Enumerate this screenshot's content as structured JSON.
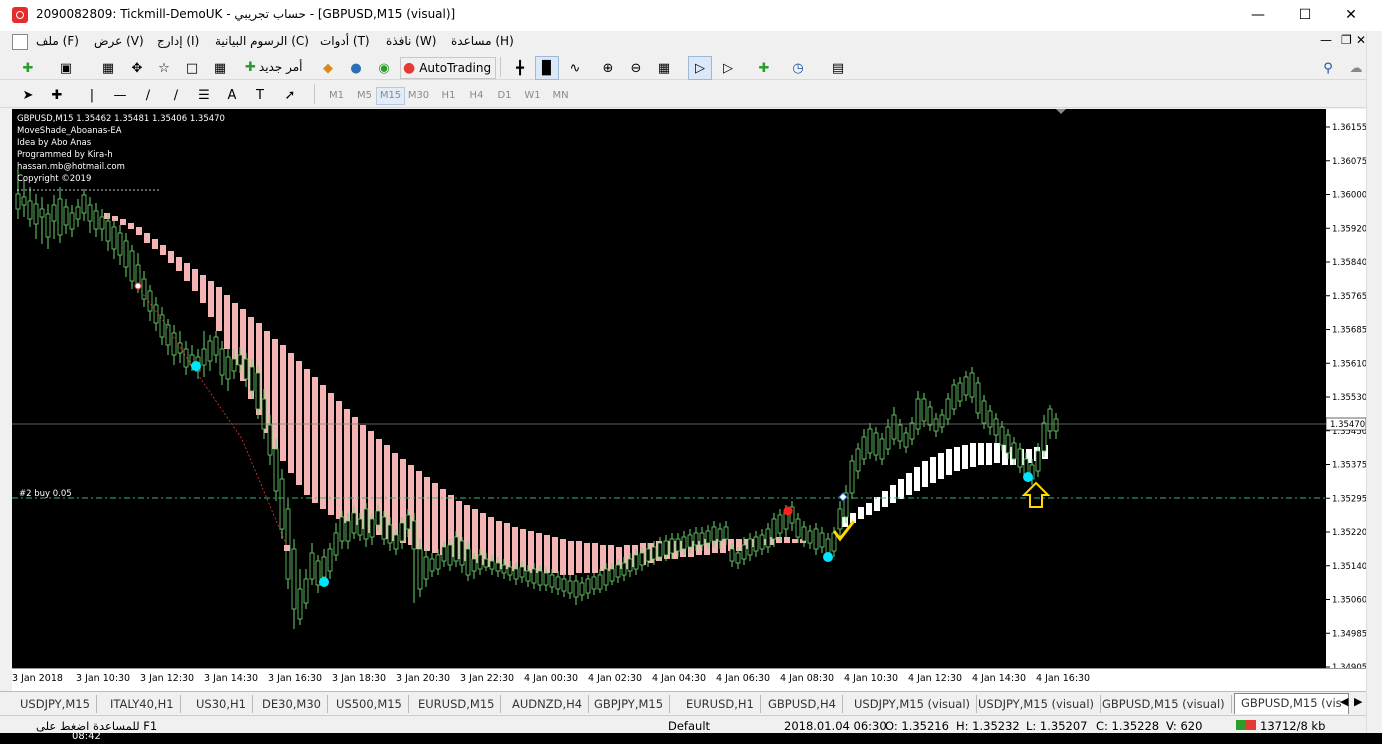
{
  "window": {
    "title": "2090082809: Tickmill-DemoUK - حساب تجريبي - [GBPUSD,M15 (visual)]"
  },
  "menu": {
    "items": [
      "ملف (F)",
      "عرض (V)",
      "إدارج (I)",
      "الرسوم البيانية (C)",
      "أدوات (T)",
      "نافذة (W)",
      "مساعدة (H)"
    ]
  },
  "toolbar": {
    "new_order": "أمر جديد",
    "autotrading": "AutoTrading"
  },
  "timeframes": [
    "M1",
    "M5",
    "M15",
    "M30",
    "H1",
    "H4",
    "D1",
    "W1",
    "MN"
  ],
  "chart": {
    "symbol_line": "GBPUSD,M15  1.35462 1.35481 1.35406 1.35470",
    "ea_lines": [
      "MoveShade_Aboanas-EA",
      "Idea by Abo Anas",
      "Programmed by Kira-h",
      "hassan.mb@hotmail.com",
      "Copyright ©2019"
    ],
    "order_label": "#2 buy 0.05",
    "current_price": "1.35470",
    "price_ticks": [
      "1.36155",
      "1.36075",
      "1.36000",
      "1.35920",
      "1.35840",
      "1.35765",
      "1.35685",
      "1.35610",
      "1.35530",
      "1.35450",
      "1.35375",
      "1.35295",
      "1.35220",
      "1.35140",
      "1.35060",
      "1.34985",
      "1.34905"
    ],
    "time_ticks": [
      "3 Jan 2018",
      "3 Jan 10:30",
      "3 Jan 12:30",
      "3 Jan 14:30",
      "3 Jan 16:30",
      "3 Jan 18:30",
      "3 Jan 20:30",
      "3 Jan 22:30",
      "4 Jan 00:30",
      "4 Jan 02:30",
      "4 Jan 04:30",
      "4 Jan 06:30",
      "4 Jan 08:30",
      "4 Jan 10:30",
      "4 Jan 12:30",
      "4 Jan 14:30",
      "4 Jan 16:30"
    ],
    "colors": {
      "bull": "#d8f7d0",
      "bear": "#6ed66e",
      "shade_down": "#f4b4b4",
      "shade_up": "#ffffff",
      "dot": "#00e5ff",
      "order_line": "#3cb371"
    }
  },
  "tabs": [
    "USDJPY,M15",
    "ITALY40,H1",
    "US30,H1",
    "DE30,M30",
    "US500,M15",
    "EURUSD,M15",
    "AUDNZD,H4",
    "GBPJPY,M15",
    "EURUSD,H1",
    "GBPUSD,H4",
    "USDJPY,M15 (visual)",
    "USDJPY,M15 (visual)",
    "GBPUSD,M15 (visual)",
    "GBPUSD,M15 (vis"
  ],
  "status": {
    "help": "للمساعدة اضغط على F1",
    "profile": "Default",
    "datetime": "2018.01.04 06:30",
    "open": "O: 1.35216",
    "high": "H: 1.35232",
    "low": "L: 1.35207",
    "close": "C: 1.35228",
    "volume": "V: 620",
    "traffic": "13712/8 kb"
  },
  "taskbar": {
    "time": "08:42"
  }
}
